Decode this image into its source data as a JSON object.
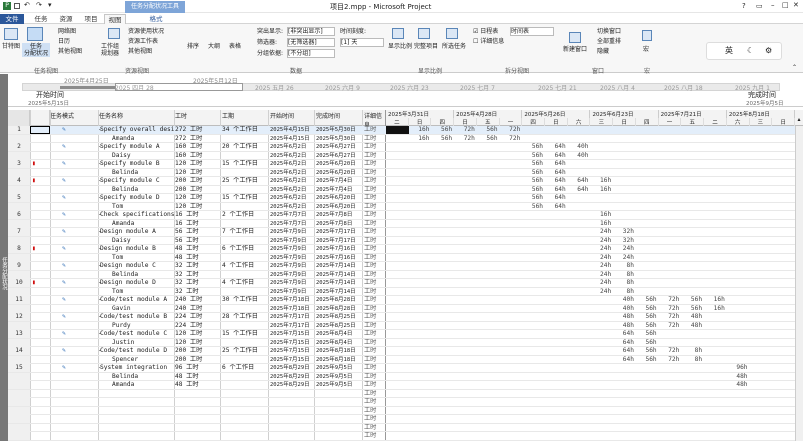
{
  "window": {
    "title": "项目2.mpp - Microsoft Project",
    "context_tab_group": "任务分配状况工具",
    "help": "?"
  },
  "tabs": [
    "文件",
    "任务",
    "资源",
    "项目",
    "视图",
    "格式"
  ],
  "ribbon": {
    "view_gantt": "甘特图",
    "task_usage": "任务\n分配状况",
    "network": "网络图",
    "calendar": "日历",
    "other_views": "其他视图",
    "team_planner": "工作组\n规划器",
    "resource_usage": "资源使用状况",
    "resource_sheet": "资源工作表",
    "other_views2": "其他视图",
    "sort": "排序",
    "outline": "大纲",
    "tables": "表格",
    "highlight_label": "突出显示:",
    "highlight_value": "[非突出显示]",
    "filter_label": "筛选器:",
    "filter_value": "[无筛选器]",
    "group_label": "分组依据:",
    "group_value": "[不分组]",
    "timescale_label": "时间刻度:",
    "timescale_value": "[1] 天",
    "zoom": "显示比例",
    "full_project": "完整项目",
    "selected_tasks": "所选任务",
    "timeline_check": "日程表",
    "timeline_value": "时间表",
    "details_check": "详细信息",
    "new_window": "新建窗口",
    "switch_window": "切换窗口",
    "arrange_all": "全部重排",
    "hide": "隐藏",
    "macros": "宏",
    "groups": [
      "任务视图",
      "资源视图",
      "数据",
      "显示比例",
      "拆分视图",
      "窗口",
      "宏"
    ]
  },
  "ime": {
    "mode": "英",
    "moon": "☾",
    "gear": "⚙"
  },
  "timeline": {
    "start_label": "开始时间",
    "start_date": "2025年5月15日",
    "finish_label": "完成时间",
    "finish_date": "2025年9月5日",
    "bar_start": "2025年4月25日",
    "bar_end": "2025年5月12日",
    "months": [
      "2025 四月 28",
      "2025 五月 26",
      "2025 六月 9",
      "2025 六月 23",
      "2025 七月 7",
      "2025 七月 21",
      "2025 八月 4",
      "2025 八月 18",
      "2025 九月 1"
    ]
  },
  "sidebar_label": "任务分配状况",
  "columns": {
    "info": "",
    "mode": "任务模式",
    "name": "任务名称",
    "work": "工时",
    "duration": "工期",
    "start": "开始时间",
    "finish": "完成时间",
    "details": "详细信息"
  },
  "usage_header": {
    "weeks": [
      "2025年3月31日",
      "2025年4月28日",
      "2025年5月26日",
      "2025年6月23日",
      "2025年7月21日",
      "2025年8月18日"
    ],
    "days": [
      "二",
      "日",
      "四",
      "日",
      "五",
      "一",
      "四",
      "日",
      "六",
      "三",
      "日",
      "四",
      "一",
      "五",
      "二",
      "六",
      "三",
      "日"
    ]
  },
  "rows": [
    {
      "id": "1",
      "icon": "",
      "name": "Specify overall desi",
      "work": "272 工时",
      "dur": "34 个工作日",
      "start": "2025年4月15日",
      "finish": "2025年5月30日",
      "vals": [
        "",
        "16h",
        "56h",
        "72h",
        "56h",
        "72h",
        "",
        "",
        "",
        "",
        "",
        "",
        "",
        "",
        "",
        "",
        "",
        ""
      ]
    },
    {
      "id": "",
      "icon": "",
      "name": "Amanda",
      "work": "272 工时",
      "dur": "",
      "start": "2025年4月15日",
      "finish": "2025年5月30日",
      "vals": [
        "",
        "16h",
        "56h",
        "72h",
        "56h",
        "72h",
        "",
        "",
        "",
        "",
        "",
        "",
        "",
        "",
        "",
        "",
        "",
        ""
      ]
    },
    {
      "id": "2",
      "icon": "",
      "name": "Specify module A",
      "work": "160 工时",
      "dur": "20 个工作日",
      "start": "2025年6月2日",
      "finish": "2025年6月27日",
      "vals": [
        "",
        "",
        "",
        "",
        "",
        "",
        "56h",
        "64h",
        "40h",
        "",
        "",
        "",
        "",
        "",
        "",
        "",
        "",
        ""
      ]
    },
    {
      "id": "",
      "icon": "",
      "name": "Daisy",
      "work": "160 工时",
      "dur": "",
      "start": "2025年6月2日",
      "finish": "2025年6月27日",
      "vals": [
        "",
        "",
        "",
        "",
        "",
        "",
        "56h",
        "64h",
        "40h",
        "",
        "",
        "",
        "",
        "",
        "",
        "",
        "",
        ""
      ]
    },
    {
      "id": "3",
      "icon": "!",
      "name": "Specify module B",
      "work": "120 工时",
      "dur": "15 个工作日",
      "start": "2025年6月2日",
      "finish": "2025年6月20日",
      "vals": [
        "",
        "",
        "",
        "",
        "",
        "",
        "56h",
        "64h",
        "",
        "",
        "",
        "",
        "",
        "",
        "",
        "",
        "",
        ""
      ]
    },
    {
      "id": "",
      "icon": "",
      "name": "Belinda",
      "work": "120 工时",
      "dur": "",
      "start": "2025年6月2日",
      "finish": "2025年6月20日",
      "vals": [
        "",
        "",
        "",
        "",
        "",
        "",
        "56h",
        "64h",
        "",
        "",
        "",
        "",
        "",
        "",
        "",
        "",
        "",
        ""
      ]
    },
    {
      "id": "4",
      "icon": "!",
      "name": "Specify module C",
      "work": "200 工时",
      "dur": "25 个工作日",
      "start": "2025年6月2日",
      "finish": "2025年7月4日",
      "vals": [
        "",
        "",
        "",
        "",
        "",
        "",
        "56h",
        "64h",
        "64h",
        "16h",
        "",
        "",
        "",
        "",
        "",
        "",
        "",
        ""
      ]
    },
    {
      "id": "",
      "icon": "",
      "name": "Belinda",
      "work": "200 工时",
      "dur": "",
      "start": "2025年6月2日",
      "finish": "2025年7月4日",
      "vals": [
        "",
        "",
        "",
        "",
        "",
        "",
        "56h",
        "64h",
        "64h",
        "16h",
        "",
        "",
        "",
        "",
        "",
        "",
        "",
        ""
      ]
    },
    {
      "id": "5",
      "icon": "",
      "name": "Specify module D",
      "work": "120 工时",
      "dur": "15 个工作日",
      "start": "2025年6月2日",
      "finish": "2025年6月20日",
      "vals": [
        "",
        "",
        "",
        "",
        "",
        "",
        "56h",
        "64h",
        "",
        "",
        "",
        "",
        "",
        "",
        "",
        "",
        "",
        ""
      ]
    },
    {
      "id": "",
      "icon": "",
      "name": "Tom",
      "work": "120 工时",
      "dur": "",
      "start": "2025年6月2日",
      "finish": "2025年6月20日",
      "vals": [
        "",
        "",
        "",
        "",
        "",
        "",
        "56h",
        "64h",
        "",
        "",
        "",
        "",
        "",
        "",
        "",
        "",
        "",
        ""
      ]
    },
    {
      "id": "6",
      "icon": "",
      "name": "Check specifications",
      "work": "16 工时",
      "dur": "2 个工作日",
      "start": "2025年7月7日",
      "finish": "2025年7月8日",
      "vals": [
        "",
        "",
        "",
        "",
        "",
        "",
        "",
        "",
        "",
        "16h",
        "",
        "",
        "",
        "",
        "",
        "",
        "",
        ""
      ]
    },
    {
      "id": "",
      "icon": "",
      "name": "Amanda",
      "work": "16 工时",
      "dur": "",
      "start": "2025年7月7日",
      "finish": "2025年7月8日",
      "vals": [
        "",
        "",
        "",
        "",
        "",
        "",
        "",
        "",
        "",
        "16h",
        "",
        "",
        "",
        "",
        "",
        "",
        "",
        ""
      ]
    },
    {
      "id": "7",
      "icon": "",
      "name": "Design module A",
      "work": "56 工时",
      "dur": "7 个工作日",
      "start": "2025年7月9日",
      "finish": "2025年7月17日",
      "vals": [
        "",
        "",
        "",
        "",
        "",
        "",
        "",
        "",
        "",
        "24h",
        "32h",
        "",
        "",
        "",
        "",
        "",
        "",
        ""
      ]
    },
    {
      "id": "",
      "icon": "",
      "name": "Daisy",
      "work": "56 工时",
      "dur": "",
      "start": "2025年7月9日",
      "finish": "2025年7月17日",
      "vals": [
        "",
        "",
        "",
        "",
        "",
        "",
        "",
        "",
        "",
        "24h",
        "32h",
        "",
        "",
        "",
        "",
        "",
        "",
        ""
      ]
    },
    {
      "id": "8",
      "icon": "!",
      "name": "Design module B",
      "work": "48 工时",
      "dur": "6 个工作日",
      "start": "2025年7月9日",
      "finish": "2025年7月16日",
      "vals": [
        "",
        "",
        "",
        "",
        "",
        "",
        "",
        "",
        "",
        "24h",
        "24h",
        "",
        "",
        "",
        "",
        "",
        "",
        ""
      ]
    },
    {
      "id": "",
      "icon": "",
      "name": "Tom",
      "work": "48 工时",
      "dur": "",
      "start": "2025年7月9日",
      "finish": "2025年7月16日",
      "vals": [
        "",
        "",
        "",
        "",
        "",
        "",
        "",
        "",
        "",
        "24h",
        "24h",
        "",
        "",
        "",
        "",
        "",
        "",
        ""
      ]
    },
    {
      "id": "9",
      "icon": "",
      "name": "Design module C",
      "work": "32 工时",
      "dur": "4 个工作日",
      "start": "2025年7月9日",
      "finish": "2025年7月14日",
      "vals": [
        "",
        "",
        "",
        "",
        "",
        "",
        "",
        "",
        "",
        "24h",
        "8h",
        "",
        "",
        "",
        "",
        "",
        "",
        ""
      ]
    },
    {
      "id": "",
      "icon": "",
      "name": "Belinda",
      "work": "32 工时",
      "dur": "",
      "start": "2025年7月9日",
      "finish": "2025年7月14日",
      "vals": [
        "",
        "",
        "",
        "",
        "",
        "",
        "",
        "",
        "",
        "24h",
        "8h",
        "",
        "",
        "",
        "",
        "",
        "",
        ""
      ]
    },
    {
      "id": "10",
      "icon": "!",
      "name": "Design module D",
      "work": "32 工时",
      "dur": "4 个工作日",
      "start": "2025年7月9日",
      "finish": "2025年7月14日",
      "vals": [
        "",
        "",
        "",
        "",
        "",
        "",
        "",
        "",
        "",
        "24h",
        "8h",
        "",
        "",
        "",
        "",
        "",
        "",
        ""
      ]
    },
    {
      "id": "",
      "icon": "",
      "name": "Tom",
      "work": "32 工时",
      "dur": "",
      "start": "2025年7月9日",
      "finish": "2025年7月14日",
      "vals": [
        "",
        "",
        "",
        "",
        "",
        "",
        "",
        "",
        "",
        "24h",
        "8h",
        "",
        "",
        "",
        "",
        "",
        "",
        ""
      ]
    },
    {
      "id": "11",
      "icon": "",
      "name": "Code/test module A",
      "work": "240 工时",
      "dur": "30 个工作日",
      "start": "2025年7月18日",
      "finish": "2025年8月28日",
      "vals": [
        "",
        "",
        "",
        "",
        "",
        "",
        "",
        "",
        "",
        "",
        "40h",
        "56h",
        "72h",
        "56h",
        "16h",
        "",
        "",
        ""
      ]
    },
    {
      "id": "",
      "icon": "",
      "name": "Gavin",
      "work": "240 工时",
      "dur": "",
      "start": "2025年7月18日",
      "finish": "2025年8月28日",
      "vals": [
        "",
        "",
        "",
        "",
        "",
        "",
        "",
        "",
        "",
        "",
        "40h",
        "56h",
        "72h",
        "56h",
        "16h",
        "",
        "",
        ""
      ]
    },
    {
      "id": "12",
      "icon": "",
      "name": "Code/test module B",
      "work": "224 工时",
      "dur": "28 个工作日",
      "start": "2025年7月17日",
      "finish": "2025年8月25日",
      "vals": [
        "",
        "",
        "",
        "",
        "",
        "",
        "",
        "",
        "",
        "",
        "48h",
        "56h",
        "72h",
        "48h",
        "",
        "",
        "",
        ""
      ]
    },
    {
      "id": "",
      "icon": "",
      "name": "Purdy",
      "work": "224 工时",
      "dur": "",
      "start": "2025年7月17日",
      "finish": "2025年8月25日",
      "vals": [
        "",
        "",
        "",
        "",
        "",
        "",
        "",
        "",
        "",
        "",
        "48h",
        "56h",
        "72h",
        "48h",
        "",
        "",
        "",
        ""
      ]
    },
    {
      "id": "13",
      "icon": "",
      "name": "Code/test module C",
      "work": "120 工时",
      "dur": "15 个工作日",
      "start": "2025年7月15日",
      "finish": "2025年8月4日",
      "vals": [
        "",
        "",
        "",
        "",
        "",
        "",
        "",
        "",
        "",
        "",
        "64h",
        "56h",
        "",
        "",
        "",
        "",
        "",
        ""
      ]
    },
    {
      "id": "",
      "icon": "",
      "name": "Justin",
      "work": "120 工时",
      "dur": "",
      "start": "2025年7月15日",
      "finish": "2025年8月4日",
      "vals": [
        "",
        "",
        "",
        "",
        "",
        "",
        "",
        "",
        "",
        "",
        "64h",
        "56h",
        "",
        "",
        "",
        "",
        "",
        ""
      ]
    },
    {
      "id": "14",
      "icon": "",
      "name": "Code/test module D",
      "work": "200 工时",
      "dur": "25 个工作日",
      "start": "2025年7月15日",
      "finish": "2025年8月18日",
      "vals": [
        "",
        "",
        "",
        "",
        "",
        "",
        "",
        "",
        "",
        "",
        "64h",
        "56h",
        "72h",
        "8h",
        "",
        "",
        "",
        ""
      ]
    },
    {
      "id": "",
      "icon": "",
      "name": "Spencer",
      "work": "200 工时",
      "dur": "",
      "start": "2025年7月15日",
      "finish": "2025年8月18日",
      "vals": [
        "",
        "",
        "",
        "",
        "",
        "",
        "",
        "",
        "",
        "",
        "64h",
        "56h",
        "72h",
        "8h",
        "",
        "",
        "",
        ""
      ]
    },
    {
      "id": "15",
      "icon": "",
      "name": "System integration",
      "work": "96 工时",
      "dur": "6 个工作日",
      "start": "2025年8月29日",
      "finish": "2025年9月5日",
      "vals": [
        "",
        "",
        "",
        "",
        "",
        "",
        "",
        "",
        "",
        "",
        "",
        "",
        "",
        "",
        "",
        "96h",
        "",
        ""
      ]
    },
    {
      "id": "",
      "icon": "",
      "name": "Belinda",
      "work": "48 工时",
      "dur": "",
      "start": "2025年8月29日",
      "finish": "2025年9月5日",
      "vals": [
        "",
        "",
        "",
        "",
        "",
        "",
        "",
        "",
        "",
        "",
        "",
        "",
        "",
        "",
        "",
        "48h",
        "",
        ""
      ]
    },
    {
      "id": "",
      "icon": "",
      "name": "Amanda",
      "work": "48 工时",
      "dur": "",
      "start": "2025年8月29日",
      "finish": "2025年9月5日",
      "vals": [
        "",
        "",
        "",
        "",
        "",
        "",
        "",
        "",
        "",
        "",
        "",
        "",
        "",
        "",
        "",
        "48h",
        "",
        ""
      ]
    }
  ],
  "detail_label": "工时",
  "colors": {
    "accent": "#2b579a",
    "context": "#7ea5d8",
    "warn": "#d01010",
    "pin": "#2f6db5"
  }
}
